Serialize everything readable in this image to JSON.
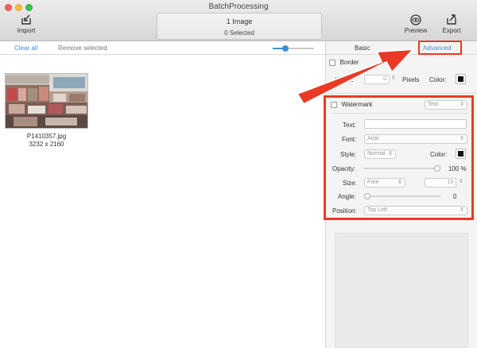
{
  "window": {
    "title": "BatchProcessing"
  },
  "toolbar": {
    "import_label": "Import",
    "preview_label": "Preview",
    "export_label": "Export",
    "status_line1": "1 Image",
    "status_line2": "0 Selected"
  },
  "subbar": {
    "clear_all": "Clear all",
    "remove_selected": "Remove selected",
    "zoom_level": 0.3
  },
  "images": [
    {
      "name": "P1410357.jpg",
      "dimensions": "3232 x 2160"
    }
  ],
  "panel": {
    "tabs": {
      "basic": "Basic",
      "advanced": "Advanced"
    },
    "border": {
      "label": "Border",
      "width_label": "Width:",
      "width_value": "0",
      "pixels_label": "Pixels",
      "color_label": "Color:",
      "color": "#111111"
    },
    "watermark": {
      "label": "Watermark",
      "type_value": "Text",
      "text_label": "Text:",
      "text_value": "",
      "font_label": "Font:",
      "font_value": "Arial",
      "style_label": "Style:",
      "style_value": "Normal",
      "color_label": "Color:",
      "opacity_label": "Opacity:",
      "opacity_value": "100 %",
      "opacity_level": 1.0,
      "size_label": "Size:",
      "size_mode": "Free",
      "size_value": "13",
      "angle_label": "Angle:",
      "angle_value": "0",
      "angle_level": 0.0,
      "position_label": "Position:",
      "position_value": "Top Left"
    }
  },
  "colors": {
    "accent": "#3a8fd9",
    "annotation_red": "#e83a25"
  },
  "icons": [
    "import-icon",
    "preview-icon",
    "export-icon",
    "annotation-arrow-icon"
  ]
}
